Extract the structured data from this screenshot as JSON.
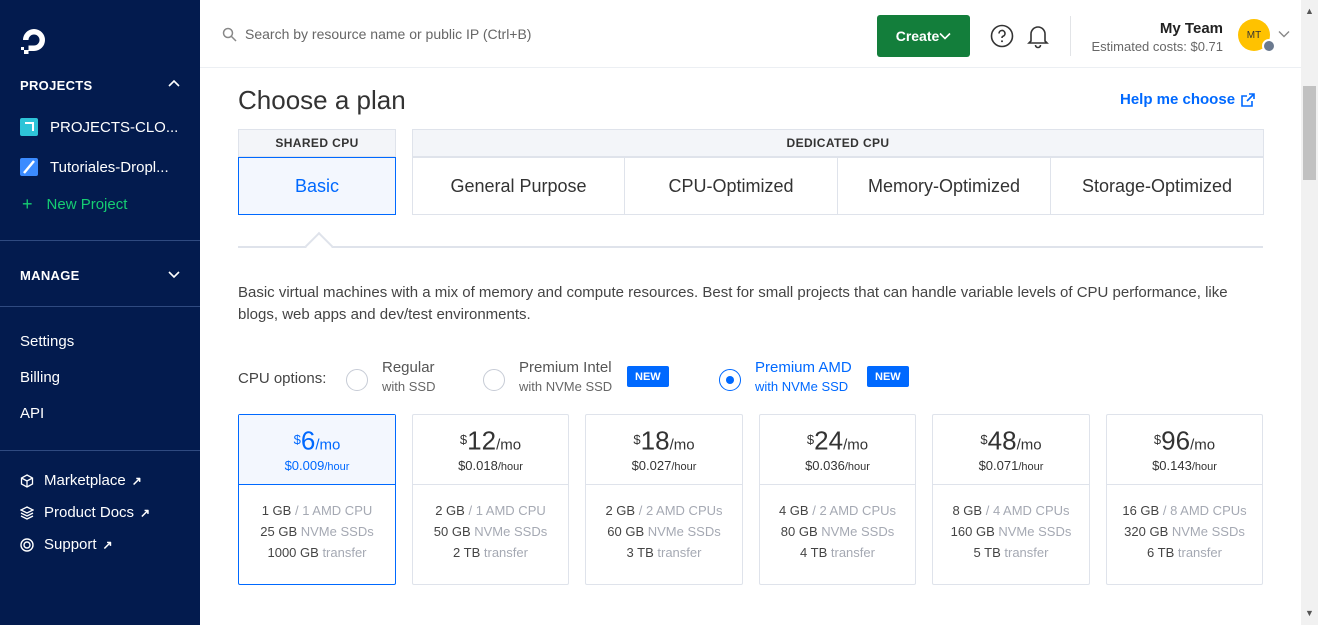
{
  "sidebar": {
    "projects_heading": "PROJECTS",
    "projects": [
      {
        "label": "PROJECTS-CLO..."
      },
      {
        "label": "Tutoriales-Dropl..."
      }
    ],
    "new_project": "New Project",
    "manage_heading": "MANAGE",
    "nav": [
      "Settings",
      "Billing",
      "API"
    ],
    "external": [
      {
        "label": "Marketplace",
        "icon": "cube-icon"
      },
      {
        "label": "Product Docs",
        "icon": "layers-icon"
      },
      {
        "label": "Support",
        "icon": "lifebuoy-icon"
      }
    ],
    "external_arrow": "↗"
  },
  "topbar": {
    "search_placeholder": "Search by resource name or public IP (Ctrl+B)",
    "create_label": "Create",
    "team_name": "My Team",
    "estimated_costs": "Estimated costs: $0.71",
    "avatar_initials": "MT"
  },
  "plan": {
    "title": "Choose a plan",
    "help_link": "Help me choose",
    "shared_label": "SHARED CPU",
    "dedicated_label": "DEDICATED CPU",
    "tabs": [
      "Basic",
      "General Purpose",
      "CPU-Optimized",
      "Memory-Optimized",
      "Storage-Optimized"
    ],
    "description": "Basic virtual machines with a mix of memory and compute resources. Best for small projects that can handle variable levels of CPU performance, like blogs, web apps and dev/test environments.",
    "cpu_options_label": "CPU options:",
    "cpu_options": [
      {
        "l1": "Regular",
        "l2": "with SSD"
      },
      {
        "l1": "Premium Intel",
        "l2": "with NVMe SSD",
        "badge": "NEW"
      },
      {
        "l1": "Premium AMD",
        "l2": "with NVMe SSD",
        "badge": "NEW",
        "selected": true
      }
    ],
    "cards": [
      {
        "price": "6",
        "hourly": "$0.009",
        "mem": "1 GB",
        "cpu": "1 AMD CPU",
        "ssd": "25 GB",
        "transfer": "1000 GB"
      },
      {
        "price": "12",
        "hourly": "$0.018",
        "mem": "2 GB",
        "cpu": "1 AMD CPU",
        "ssd": "50 GB",
        "transfer": "2 TB"
      },
      {
        "price": "18",
        "hourly": "$0.027",
        "mem": "2 GB",
        "cpu": "2 AMD CPUs",
        "ssd": "60 GB",
        "transfer": "3 TB"
      },
      {
        "price": "24",
        "hourly": "$0.036",
        "mem": "4 GB",
        "cpu": "2 AMD CPUs",
        "ssd": "80 GB",
        "transfer": "4 TB"
      },
      {
        "price": "48",
        "hourly": "$0.071",
        "mem": "8 GB",
        "cpu": "4 AMD CPUs",
        "ssd": "160 GB",
        "transfer": "5 TB"
      },
      {
        "price": "96",
        "hourly": "$0.143",
        "mem": "16 GB",
        "cpu": "8 AMD CPUs",
        "ssd": "320 GB",
        "transfer": "6 TB"
      }
    ],
    "currency": "$",
    "per_month": "/mo",
    "per_hour": "/hour",
    "ssd_suffix": "NVMe SSDs",
    "transfer_suffix": "transfer",
    "cpu_sep": " / "
  },
  "colors": {
    "accent": "#0069ff",
    "sidebar": "#031b4e",
    "create": "#137e3b",
    "new_project": "#15cd72"
  }
}
